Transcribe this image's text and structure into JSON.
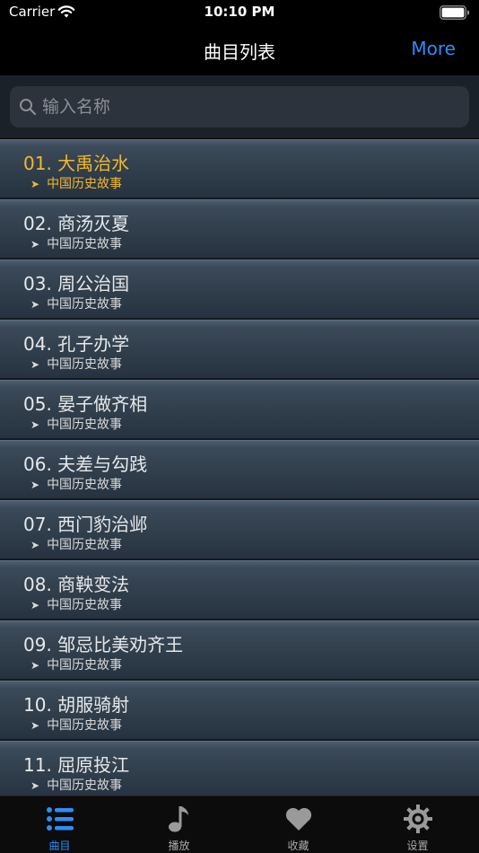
{
  "status_bar": {
    "carrier": "Carrier",
    "time": "10:10 PM"
  },
  "nav": {
    "title": "曲目列表",
    "more_label": "More"
  },
  "search": {
    "placeholder": "输入名称",
    "value": ""
  },
  "tracks": [
    {
      "title": "01. 大禹治水",
      "subtitle": "中国历史故事",
      "active": true
    },
    {
      "title": "02. 商汤灭夏",
      "subtitle": "中国历史故事"
    },
    {
      "title": "03. 周公治国",
      "subtitle": "中国历史故事"
    },
    {
      "title": "04. 孔子办学",
      "subtitle": "中国历史故事"
    },
    {
      "title": "05. 晏子做齐相",
      "subtitle": "中国历史故事"
    },
    {
      "title": "06. 夫差与勾践",
      "subtitle": "中国历史故事"
    },
    {
      "title": "07. 西门豹治邺",
      "subtitle": "中国历史故事"
    },
    {
      "title": "08. 商鞅变法",
      "subtitle": "中国历史故事"
    },
    {
      "title": "09. 邹忌比美劝齐王",
      "subtitle": "中国历史故事"
    },
    {
      "title": "10. 胡服骑射",
      "subtitle": "中国历史故事"
    },
    {
      "title": "11. 屈原投江",
      "subtitle": "中国历史故事"
    }
  ],
  "tabs": [
    {
      "label": "曲目",
      "icon": "list-icon",
      "active": true
    },
    {
      "label": "播放",
      "icon": "music-note-icon"
    },
    {
      "label": "收藏",
      "icon": "heart-icon"
    },
    {
      "label": "设置",
      "icon": "gear-icon"
    }
  ],
  "colors": {
    "accent": "#2f8cf6",
    "active_track": "#f3b82e",
    "row": "#2f3c49"
  }
}
